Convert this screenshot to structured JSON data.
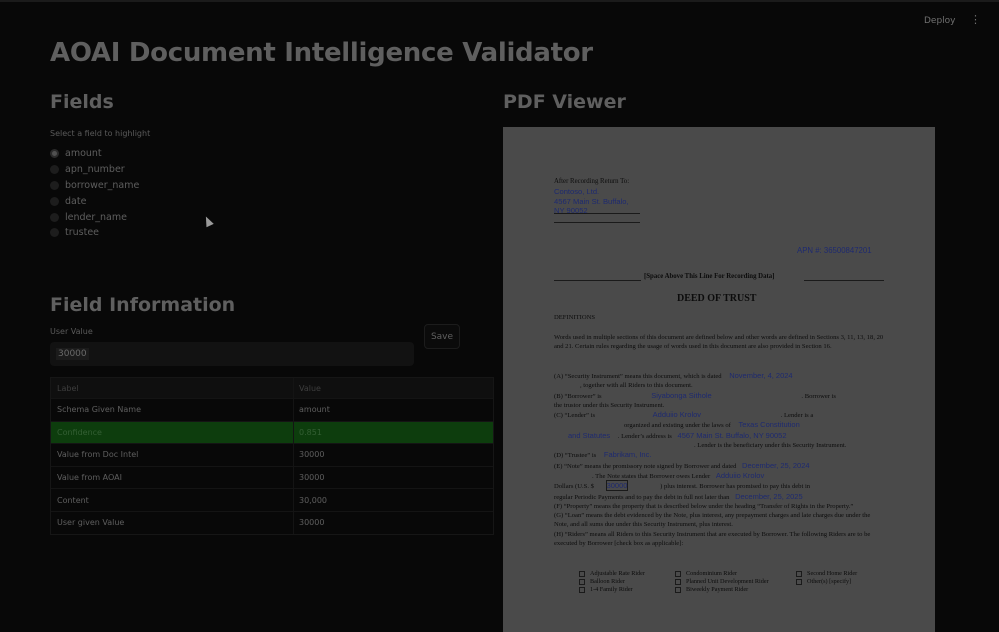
{
  "header": {
    "deploy_label": "Deploy",
    "menu_glyph": "⋮"
  },
  "app": {
    "title": "AOAI Document Intelligence Validator"
  },
  "fields": {
    "heading": "Fields",
    "radio_label": "Select a field to highlight",
    "options": [
      "amount",
      "apn_number",
      "borrower_name",
      "date",
      "lender_name",
      "trustee"
    ],
    "selected": "amount"
  },
  "field_info": {
    "heading": "Field Information",
    "user_value_label": "User Value",
    "user_value": "30000",
    "save_label": "Save",
    "table": {
      "columns": [
        "Label",
        "Value"
      ],
      "rows": [
        [
          "Schema Given Name",
          "amount"
        ],
        [
          "Confidence",
          "0.851"
        ],
        [
          "Value from Doc Intel",
          "30000"
        ],
        [
          "Value from AOAI",
          "30000"
        ],
        [
          "Content",
          "30,000"
        ],
        [
          "User given Value",
          "30000"
        ]
      ],
      "highlighted_row": 1,
      "highlight_color": "#0d3d0d"
    }
  },
  "pdf_viewer": {
    "heading": "PDF Viewer",
    "return_to_label": "After Recording Return To:",
    "return_to_lines": [
      "Contoso, Ltd.",
      "4567 Main St. Buffalo,",
      "NY 90052"
    ],
    "apn": "APN #: 36500847201",
    "space_above": "[Space Above This Line For Recording Data]",
    "title": "DEED OF TRUST",
    "definitions": "DEFINITIONS",
    "intro": "Words used in multiple sections of this document are defined below and other words are defined in Sections 3, 11, 13, 18, 20 and 21. Certain rules regarding the usage of words used in this document are also provided in Section 16.",
    "security_a": "(A) “Security Instrument” means this document, which is dated",
    "security_date": "November, 4, 2024",
    "security_b": ", together with all Riders to this document.",
    "borrower_a": "(B) “Borrower” is",
    "borrower_name": "Siyabonga Sithole",
    "borrower_b": ". Borrower is",
    "borrower_c": "the trustor under this Security Instrument.",
    "lender_a": "(C) “Lender” is",
    "lender_name": "Adduiio Krolov",
    "lender_b": ". Lender is a",
    "lender_c": "organized and existing under the laws of",
    "lender_state": "Texas Constitution",
    "lender_state2": "and Statutes",
    "lender_addr_label": ". Lender’s address is",
    "lender_addr": "4567 Main St. Buffalo, NY 90052",
    "lender_d": ". Lender is the beneficiary under this Security Instrument.",
    "trustee_a": "(D) “Trustee” is",
    "trustee_name": "Fabrikam, Inc.",
    "note_a": "(E) “Note” means the promissory note signed by Borrower and dated",
    "note_date": "December, 25, 2024",
    "note_b": ". The Note states that Borrower owes Lender",
    "note_lender": "Adduiio Krolov",
    "note_c": "Dollars (U.S. $",
    "note_amount": "30000",
    "note_d": ") plus interest. Borrower has promised to pay this debt in",
    "note_e": "regular Periodic Payments and to pay the debt in full not later than",
    "note_due": "December, 25, 2025",
    "property": "(F) “Property” means the property that is described below under the heading “Transfer of Rights in the Property.”",
    "loan": "(G) “Loan” means the debt evidenced by the Note, plus interest, any prepayment charges and late charges due under the Note, and all sums due under this Security Instrument, plus interest.",
    "riders": "(H) “Riders” means all Riders to this Security Instrument that are executed by Borrower. The following Riders are to be executed by Borrower [check box as applicable]:",
    "rider_cols": [
      [
        "Adjustable Rate Rider",
        "Balloon Rider",
        "1-4 Family Rider"
      ],
      [
        "Condominium Rider",
        "Planned Unit Development Rider",
        "Biweekly Payment Rider"
      ],
      [
        "Second Home Rider",
        "Other(s) [specify]"
      ]
    ]
  }
}
